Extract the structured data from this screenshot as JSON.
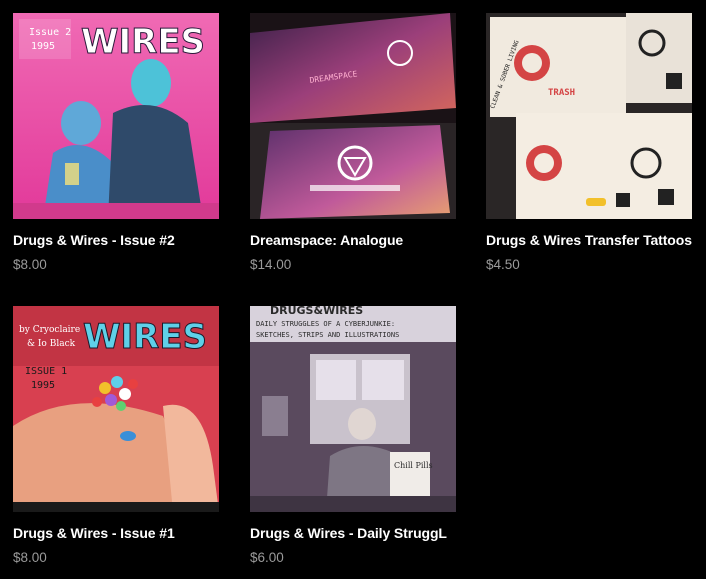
{
  "products": [
    {
      "title": "Drugs & Wires - Issue #2",
      "price": "$8.00",
      "cover_text": [
        "Issue 2",
        "1995",
        "WIRES"
      ]
    },
    {
      "title": "Dreamspace: Analogue",
      "price": "$14.00",
      "cover_text": [
        "DREAMSPACE"
      ]
    },
    {
      "title": "Drugs & Wires Transfer Tattoos",
      "price": "$4.50",
      "cover_text": [
        "TRASH",
        "CLEAN & SOBER LIVING"
      ]
    },
    {
      "title": "Drugs & Wires - Issue #1",
      "price": "$8.00",
      "cover_text": [
        "by Cryoclaire",
        "& Io Black",
        "WIRES",
        "ISSUE 1",
        "1995"
      ]
    },
    {
      "title": "Drugs & Wires - Daily StruggL",
      "price": "$6.00",
      "cover_text": [
        "DRUGS&WIRES",
        "DAILY STRUGGLES OF A CYBERJUNKIE:",
        "SKETCHES, STRIPS AND ILLUSTRATIONS",
        "Chill Pills"
      ]
    }
  ],
  "colors": {
    "background": "#000000",
    "title": "#ffffff",
    "price": "#9a9a9a"
  }
}
